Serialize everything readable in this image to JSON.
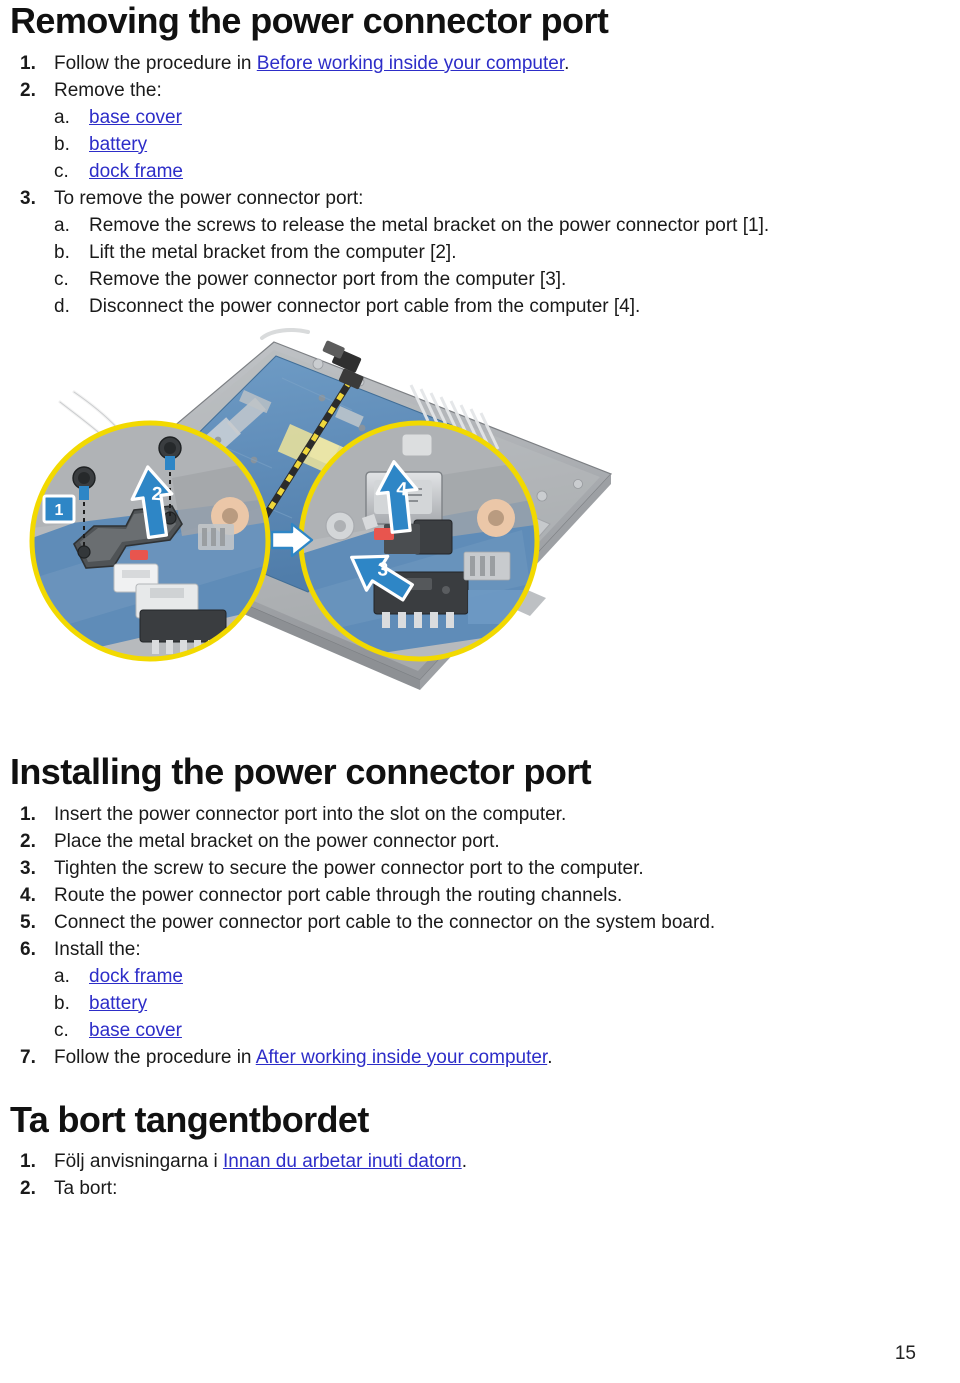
{
  "document": {
    "page_number": "15"
  },
  "section_removing": {
    "heading": "Removing the power connector port",
    "steps": [
      {
        "num": "1.",
        "text_before": "Follow the procedure in ",
        "link": "Before working inside your computer",
        "text_after": "."
      },
      {
        "num": "2.",
        "text_before": "Remove the:",
        "link": "",
        "text_after": ""
      }
    ],
    "remove_substeps": [
      {
        "letter": "a.",
        "link": "base cover"
      },
      {
        "letter": "b.",
        "link": "battery"
      },
      {
        "letter": "c.",
        "link": "dock frame"
      }
    ],
    "step3": {
      "num": "3.",
      "text": "To remove the power connector port:"
    },
    "step3_substeps": [
      {
        "letter": "a.",
        "text": "Remove the screws to release the metal bracket on the power connector port [1]."
      },
      {
        "letter": "b.",
        "text": "Lift the metal bracket from the computer [2]."
      },
      {
        "letter": "c.",
        "text": "Remove the power connector port from the computer [3]."
      },
      {
        "letter": "d.",
        "text": "Disconnect the power connector port cable from the computer [4]."
      }
    ]
  },
  "figure": {
    "alt": "Exploded view of laptop base with system board showing power connector port removal",
    "callouts": [
      {
        "id": "1",
        "type": "badge",
        "label": "1",
        "meaning": "screws"
      },
      {
        "id": "2",
        "type": "arrow",
        "label": "2",
        "meaning": "lift metal bracket"
      },
      {
        "id": "3",
        "type": "arrow",
        "label": "3",
        "meaning": "remove power connector port"
      },
      {
        "id": "4",
        "type": "arrow",
        "label": "4",
        "meaning": "disconnect cable"
      }
    ],
    "colors": {
      "callout_circle": "#F2D900",
      "arrow_blue": "#1F7FC4",
      "badge_blue": "#1F7FC4",
      "pcb_blue": "#5B88B8",
      "chassis_grey": "#AFB2B5",
      "cable_yellow": "#E8D63A"
    }
  },
  "section_installing": {
    "heading": "Installing the power connector port",
    "steps": [
      {
        "num": "1.",
        "text": "Insert the power connector port into the slot on the computer."
      },
      {
        "num": "2.",
        "text": "Place the metal bracket on the power connector port."
      },
      {
        "num": "3.",
        "text": "Tighten the screw to secure the power connector port to the computer."
      },
      {
        "num": "4.",
        "text": "Route the power connector port cable through the routing channels."
      },
      {
        "num": "5.",
        "text": "Connect the power connector port cable to the connector on the system board."
      },
      {
        "num": "6.",
        "text": "Install the:"
      }
    ],
    "install_substeps": [
      {
        "letter": "a.",
        "link": "dock frame"
      },
      {
        "letter": "b.",
        "link": "battery"
      },
      {
        "letter": "c.",
        "link": "base cover"
      }
    ],
    "step7": {
      "num": "7.",
      "text_before": "Follow the procedure in ",
      "link": "After working inside your computer",
      "text_after": "."
    }
  },
  "section_swedish": {
    "heading": "Ta bort tangentbordet",
    "steps": [
      {
        "num": "1.",
        "text_before": "Följ anvisningarna i ",
        "link": "Innan du arbetar inuti datorn",
        "text_after": "."
      },
      {
        "num": "2.",
        "text_before": "Ta bort:",
        "link": "",
        "text_after": ""
      }
    ]
  }
}
